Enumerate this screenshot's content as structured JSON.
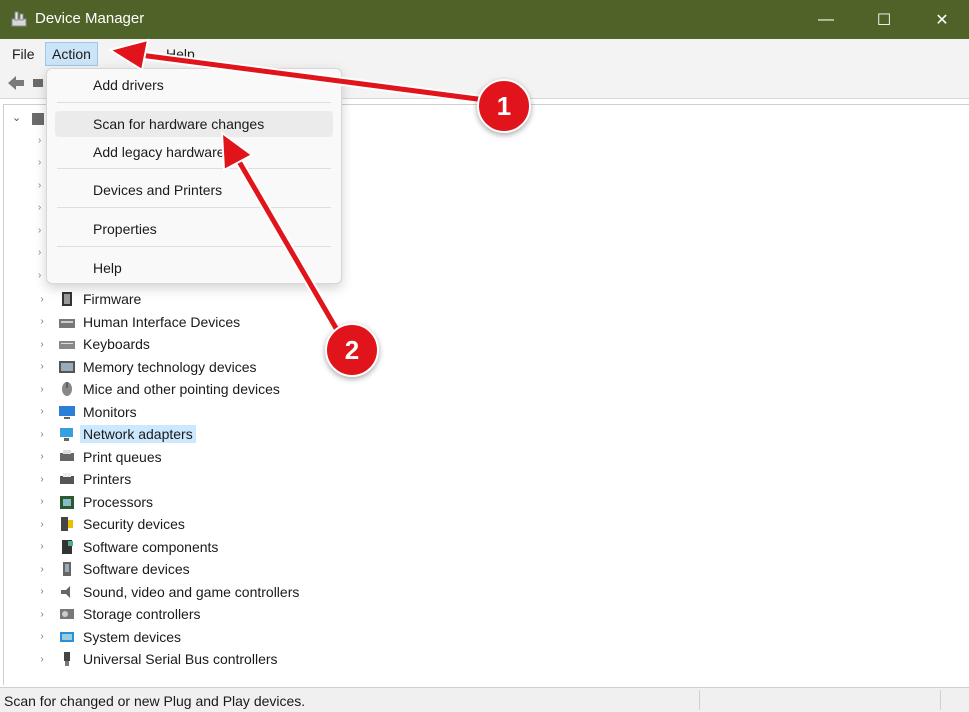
{
  "window": {
    "title": "Device Manager",
    "minimize_glyph": "—",
    "maximize_glyph": "☐",
    "close_glyph": "✕"
  },
  "menu": {
    "file": "File",
    "action": "Action",
    "help": "Help"
  },
  "action_menu": {
    "items": [
      "Add drivers",
      "Scan for hardware changes",
      "Add legacy hardware",
      "Devices and Printers",
      "Properties",
      "Help"
    ]
  },
  "tree": {
    "items": [
      {
        "label": "Firmware",
        "icon": "firmware-icon"
      },
      {
        "label": "Human Interface Devices",
        "icon": "hid-icon"
      },
      {
        "label": "Keyboards",
        "icon": "keyboard-icon"
      },
      {
        "label": "Memory technology devices",
        "icon": "memory-icon"
      },
      {
        "label": "Mice and other pointing devices",
        "icon": "mouse-icon"
      },
      {
        "label": "Monitors",
        "icon": "monitor-icon"
      },
      {
        "label": "Network adapters",
        "icon": "network-icon",
        "selected": true
      },
      {
        "label": "Print queues",
        "icon": "print-queue-icon"
      },
      {
        "label": "Printers",
        "icon": "printer-icon"
      },
      {
        "label": "Processors",
        "icon": "processor-icon"
      },
      {
        "label": "Security devices",
        "icon": "security-icon"
      },
      {
        "label": "Software components",
        "icon": "software-component-icon"
      },
      {
        "label": "Software devices",
        "icon": "software-device-icon"
      },
      {
        "label": "Sound, video and game controllers",
        "icon": "sound-icon"
      },
      {
        "label": "Storage controllers",
        "icon": "storage-icon"
      },
      {
        "label": "System devices",
        "icon": "system-icon"
      },
      {
        "label": "Universal Serial Bus controllers",
        "icon": "usb-icon"
      }
    ]
  },
  "status": {
    "text": "Scan for changed or new Plug and Play devices."
  },
  "annotations": {
    "badge1": "1",
    "badge2": "2"
  },
  "colors": {
    "titlebar": "#4f6228",
    "badge": "#e1141b",
    "selection": "#cce8ff"
  }
}
